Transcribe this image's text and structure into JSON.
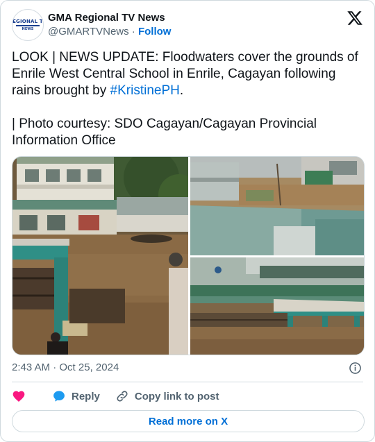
{
  "author": {
    "name": "GMA Regional TV News",
    "handle": "@GMARTVNews",
    "separator": " · ",
    "follow_label": "Follow",
    "avatar_logo_top": "REGIONAL TV",
    "avatar_logo_bottom": "NEWS"
  },
  "tweet": {
    "line1": "LOOK | NEWS UPDATE: Floodwaters cover the grounds of Enrile West Central School in Enrile, Cagayan following rains brought by ",
    "hashtag": "#KristinePH",
    "line1_end": ".",
    "line2": "| Photo courtesy: SDO Cagayan/Cagayan Provincial Information Office"
  },
  "meta": {
    "time": "2:43 AM",
    "separator": " · ",
    "date": "Oct 25, 2024"
  },
  "actions": {
    "reply_label": "Reply",
    "copy_label": "Copy link to post"
  },
  "read_more_label": "Read more on X",
  "colors": {
    "accent": "#006fd6",
    "like": "#f91880",
    "reply": "#1d9bf0",
    "muted": "#536471",
    "border": "#cfd9de"
  },
  "icons": [
    "x-logo-icon",
    "info-icon",
    "heart-icon",
    "reply-bubble-icon",
    "link-icon"
  ]
}
